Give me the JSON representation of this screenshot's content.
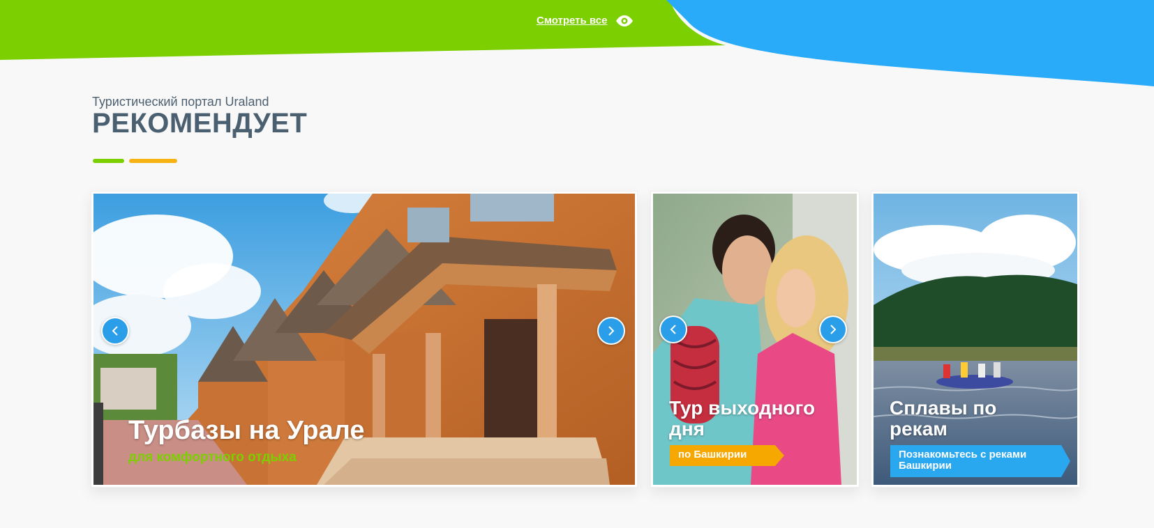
{
  "header": {
    "view_all_label": "Смотреть все",
    "view_icon": "eye-icon",
    "colors": {
      "green": "#7ccf00",
      "blue": "#29abf9"
    }
  },
  "section": {
    "subtitle": "Туристический портал Uraland",
    "title": "РЕКОМЕНДУЕТ"
  },
  "cards": [
    {
      "title": "Турбазы на Урале",
      "subtitle": "для комфортного отдыха",
      "prev_icon": "chevron-left-icon",
      "next_icon": "chevron-right-icon"
    },
    {
      "title_line1": "Тур выходного",
      "title_line2": "дня",
      "tag": "по Башкирии",
      "prev_icon": "chevron-left-icon",
      "next_icon": "chevron-right-icon"
    },
    {
      "title_line1": "Сплавы по",
      "title_line2": "рекам",
      "tag_line1": "Познакомьтесь с реками",
      "tag_line2": "Башкирии"
    }
  ]
}
